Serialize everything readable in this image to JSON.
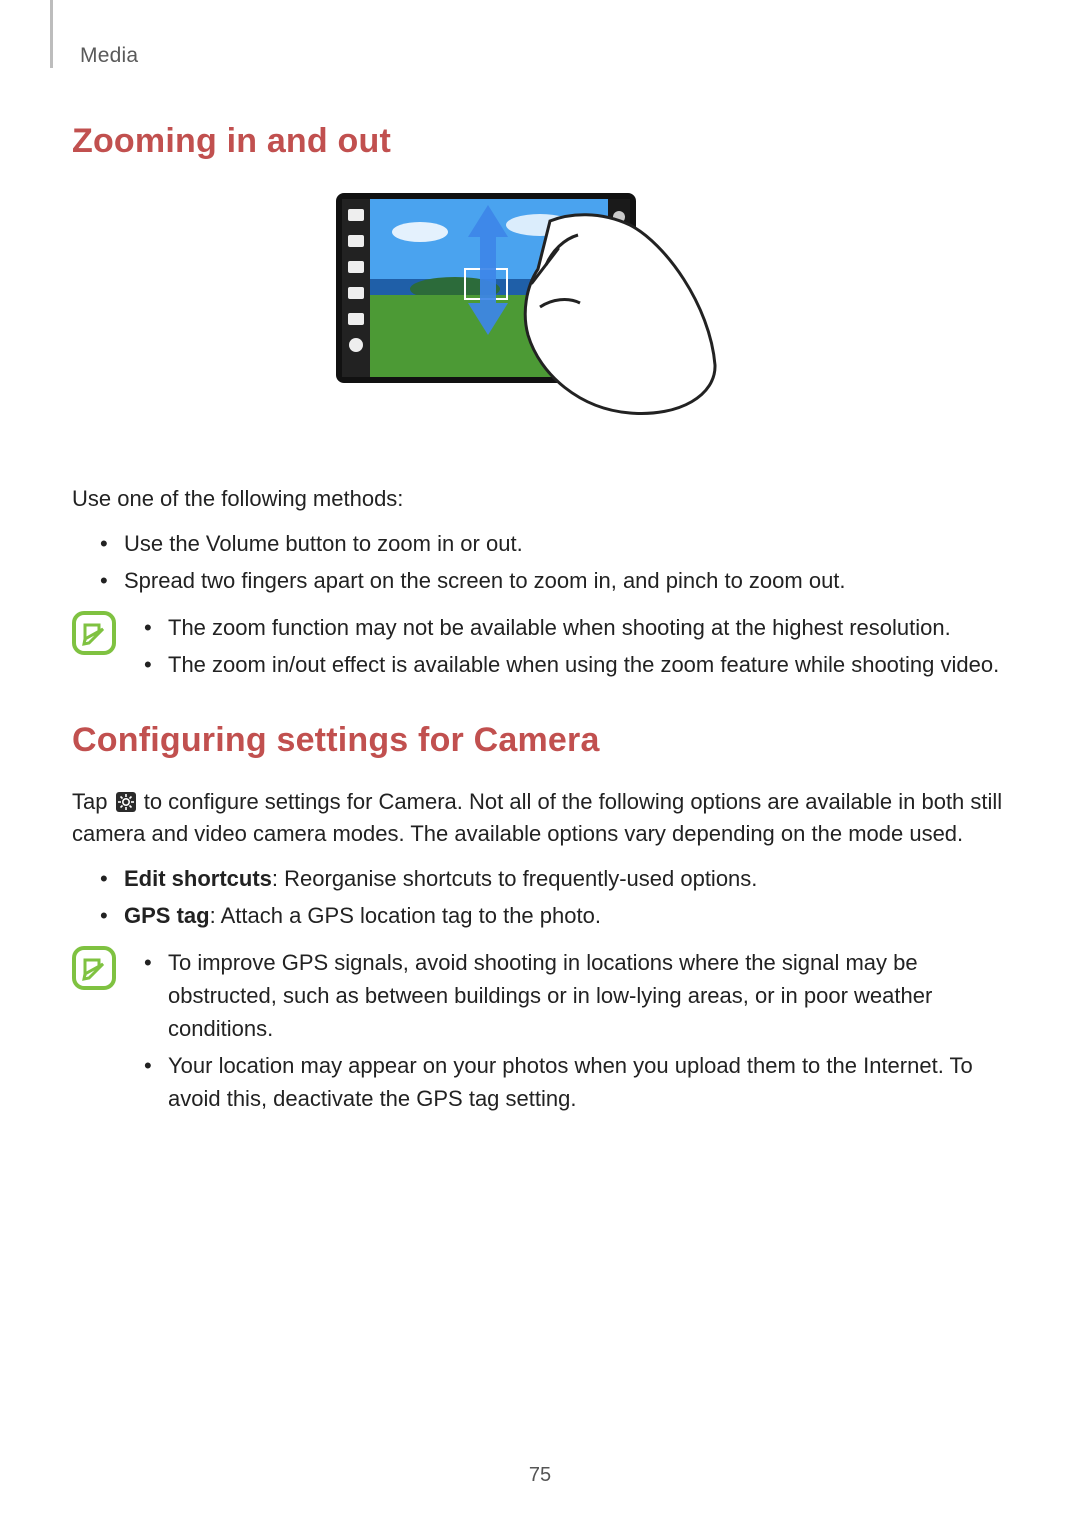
{
  "breadcrumb": "Media",
  "page_number": "75",
  "section1": {
    "title": "Zooming in and out",
    "intro": "Use one of the following methods:",
    "bullets": [
      "Use the Volume button to zoom in or out.",
      "Spread two fingers apart on the screen to zoom in, and pinch to zoom out."
    ],
    "note_bullets": [
      "The zoom function may not be available when shooting at the highest resolution.",
      "The zoom in/out effect is available when using the zoom feature while shooting video."
    ]
  },
  "section2": {
    "title": "Configuring settings for Camera",
    "intro_pre": "Tap ",
    "intro_post": " to configure settings for Camera. Not all of the following options are available in both still camera and video camera modes. The available options vary depending on the mode used.",
    "bullets": [
      {
        "bold": "Edit shortcuts",
        "rest": ": Reorganise shortcuts to frequently-used options."
      },
      {
        "bold": "GPS tag",
        "rest": ": Attach a GPS location tag to the photo."
      }
    ],
    "note_bullets": [
      "To improve GPS signals, avoid shooting in locations where the signal may be obstructed, such as between buildings or in low-lying areas, or in poor weather conditions.",
      "Your location may appear on your photos when you upload them to the Internet. To avoid this, deactivate the GPS tag setting."
    ]
  }
}
